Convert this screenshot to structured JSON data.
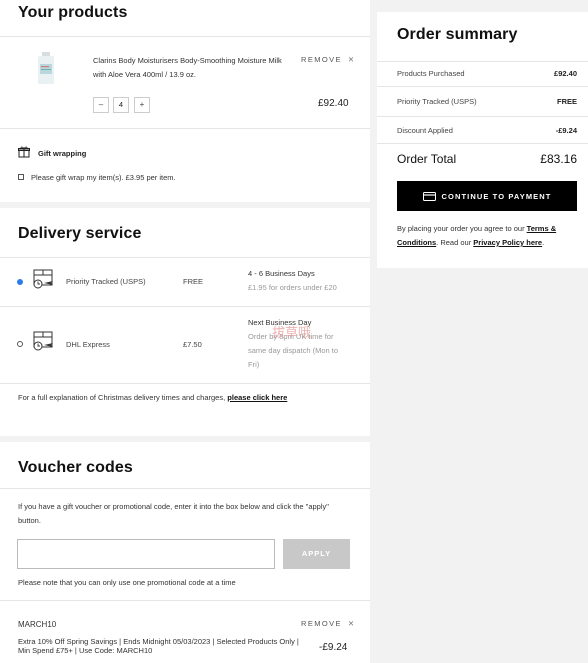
{
  "products": {
    "title": "Your products",
    "item": {
      "name": "Clarins Body Moisturisers Body-Smoothing Moisture Milk with Aloe Vera 400ml / 13.9 oz.",
      "remove_label": "REMOVE",
      "decrement": "–",
      "quantity": "4",
      "increment": "+",
      "price": "£92.40"
    },
    "gift": {
      "title": "Gift wrapping",
      "checkbox_label": "Please gift wrap my item(s). £3.95 per item."
    }
  },
  "delivery": {
    "title": "Delivery service",
    "options": [
      {
        "name": "Priority Tracked (USPS)",
        "price": "FREE",
        "days": "4 - 6 Business Days",
        "note": "£1.95 for orders under £20",
        "selected": true
      },
      {
        "name": "DHL Express",
        "price": "£7.50",
        "days": "Next Business Day",
        "note": "Order by 8pm UK time for same day dispatch (Mon to Fri)",
        "selected": false
      }
    ],
    "explanation": "For a full explanation of Christmas delivery times and charges,",
    "explanation_link": "please click here",
    "watermark": "拔草哦"
  },
  "voucher": {
    "title": "Voucher codes",
    "intro": "If you have a gift voucher or promotional code, enter it into the box below and click the \"apply\" button.",
    "input_value": "",
    "apply_label": "APPLY",
    "note": "Please note that you can only use one promotional code at a time",
    "applied": {
      "code": "MARCH10",
      "remove_label": "REMOVE",
      "description": "Extra 10% Off Spring Savings | Ends Midnight 05/03/2023 | Selected Products Only | Min Spend £75+ | Use Code: MARCH10",
      "amount": "-£9.24"
    }
  },
  "summary": {
    "title": "Order summary",
    "rows": [
      {
        "label": "Products Purchased",
        "value": "£92.40"
      },
      {
        "label": "Priority Tracked (USPS)",
        "value": "FREE"
      },
      {
        "label": "Discount Applied",
        "value": "-£9.24"
      }
    ],
    "total_label": "Order Total",
    "total_value": "£83.16",
    "pay_label": "CONTINUE TO PAYMENT",
    "terms_prefix": "By placing your order you agree to our",
    "terms_link": "Terms & Conditions",
    "terms_mid": ". Read our",
    "privacy_link": "Privacy Policy here",
    "terms_end": "."
  }
}
